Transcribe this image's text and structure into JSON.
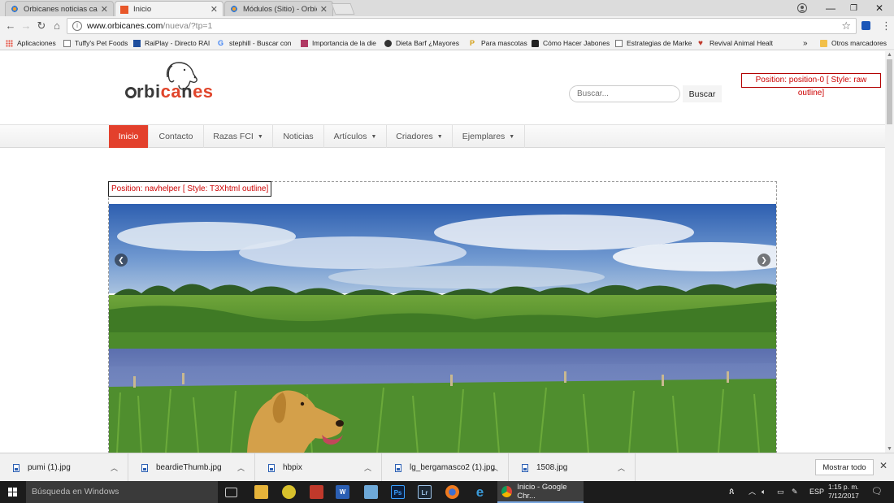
{
  "browser": {
    "tabs": [
      {
        "label": "Orbicanes noticias canin",
        "favicon": "joomla-icon",
        "active": false
      },
      {
        "label": "Inicio",
        "favicon": "orbicanes-icon",
        "active": true
      },
      {
        "label": "Módulos (Sitio) - Orbican",
        "favicon": "joomla-icon",
        "active": false
      }
    ],
    "url_host": "www.orbicanes.com",
    "url_path": "/nueva/?tp=1",
    "bookmarks": [
      {
        "label": "Aplicaciones",
        "icon": "apps-grid-icon"
      },
      {
        "label": "Tuffy's Pet Foods",
        "icon": "page-icon"
      },
      {
        "label": "RaiPlay - Directo RAI",
        "icon": "rai-icon"
      },
      {
        "label": "stephill - Buscar con",
        "icon": "google-icon"
      },
      {
        "label": "Importancia de la die",
        "icon": "magazine-icon"
      },
      {
        "label": "Dieta Barf ¿Mayores",
        "icon": "dog-icon"
      },
      {
        "label": "Para mascotas",
        "icon": "p-icon"
      },
      {
        "label": "Cómo Hacer Jabones",
        "icon": "bottle-icon"
      },
      {
        "label": "Estrategias de Marke",
        "icon": "page-icon"
      },
      {
        "label": "Revival Animal Healt",
        "icon": "heart-icon"
      }
    ],
    "bookmarks_overflow": "»",
    "other_bookmarks": "Otros marcadores"
  },
  "site": {
    "logo_text_dark_1": "rbi",
    "logo_text_red": "ca",
    "logo_text_dark_2": "n",
    "logo_text_red_2": "es",
    "search_placeholder": "Buscar...",
    "search_button": "Buscar",
    "position0_label": "Position: position-0 [ Style: raw outline]",
    "nav": [
      {
        "label": "Inicio",
        "dropdown": false,
        "active": true
      },
      {
        "label": "Contacto",
        "dropdown": false,
        "active": false
      },
      {
        "label": "Razas FCI",
        "dropdown": true,
        "active": false
      },
      {
        "label": "Noticias",
        "dropdown": false,
        "active": false
      },
      {
        "label": "Artículos",
        "dropdown": true,
        "active": false
      },
      {
        "label": "Criadores",
        "dropdown": true,
        "active": false
      },
      {
        "label": "Ejemplares",
        "dropdown": true,
        "active": false
      }
    ],
    "navhelper_label": "Position: navhelper [ Style: T3Xhtml outline]",
    "accent_color": "#e3402c"
  },
  "downloads": {
    "items": [
      {
        "name": "pumi (1).jpg"
      },
      {
        "name": "beardieThumb.jpg"
      },
      {
        "name": "hbpix"
      },
      {
        "name": "lg_bergamasco2 (1).jpg"
      },
      {
        "name": "1508.jpg"
      }
    ],
    "show_all": "Mostrar todo"
  },
  "taskbar": {
    "search_placeholder": "Búsqueda en Windows",
    "active_app": "Inicio - Google Chr...",
    "language": "ESP",
    "time": "1:15 p. m.",
    "date": "7/12/2017"
  }
}
